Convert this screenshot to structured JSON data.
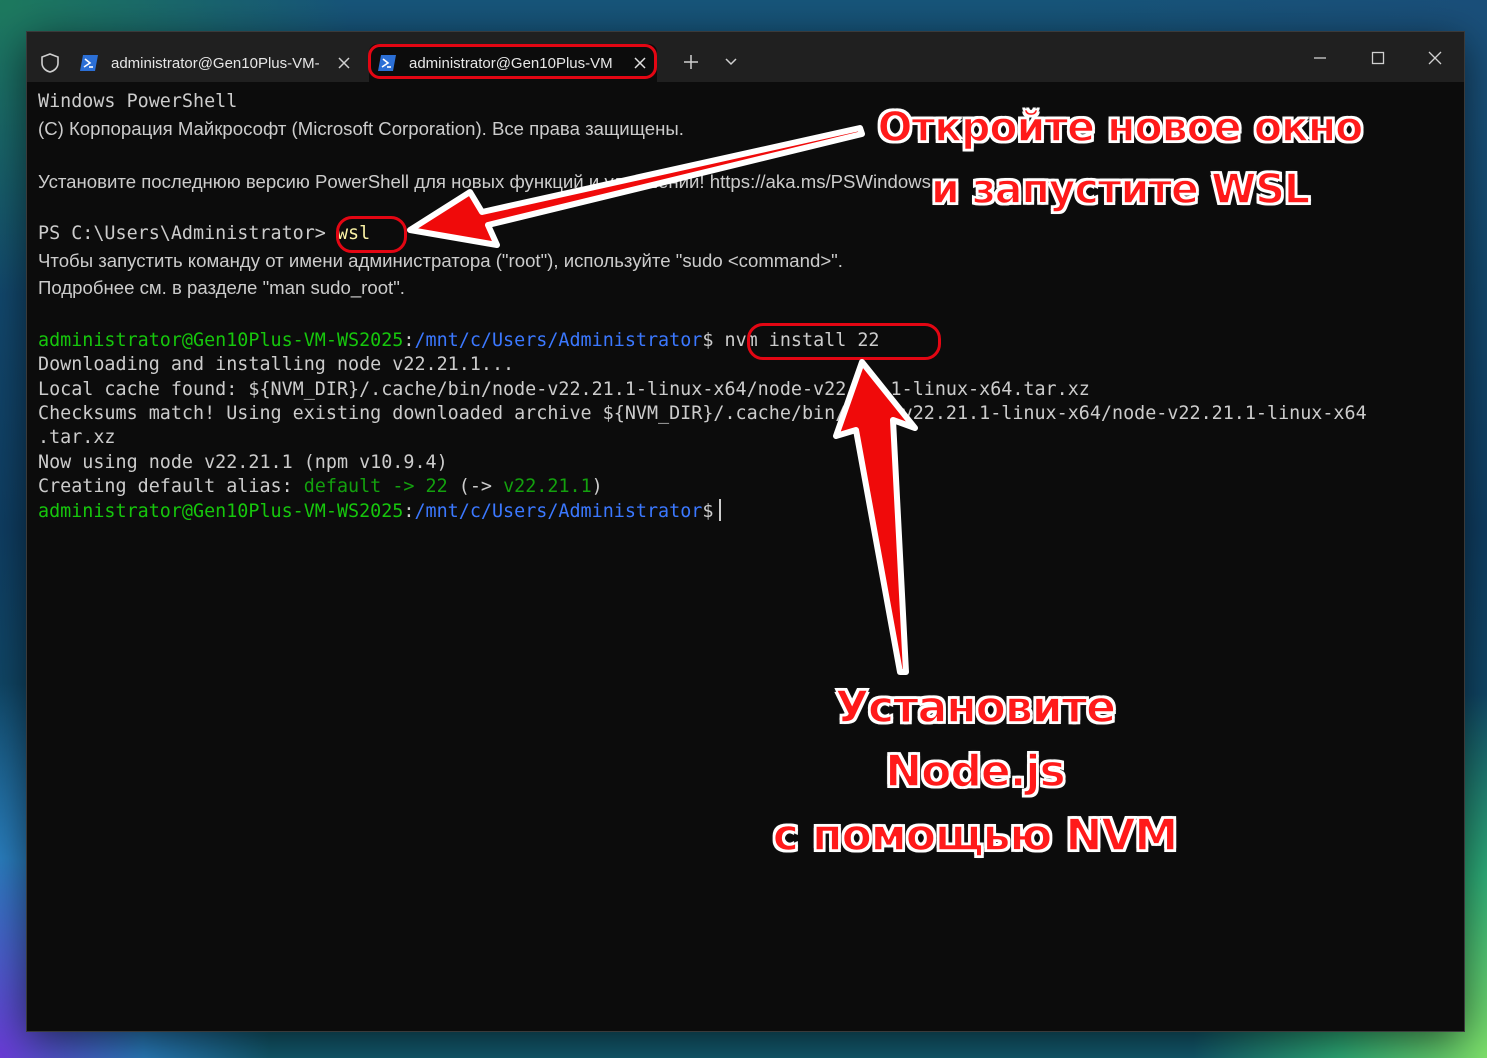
{
  "tabs": [
    {
      "label": "administrator@Gen10Plus-VM-",
      "icon": "powershell-icon",
      "active": false
    },
    {
      "label": "administrator@Gen10Plus-VM",
      "icon": "powershell-icon",
      "active": true
    }
  ],
  "terminal": {
    "header1": "Windows PowerShell",
    "header2": "(C) Корпорация Майкрософт (Microsoft Corporation). Все права защищены.",
    "tip": "Установите последнюю версию PowerShell для новых функций и улучшений! https://aka.ms/PSWindows",
    "ps_prompt": "PS C:\\Users\\Administrator>",
    "ps_cmd": "wsl",
    "sudo1": "Чтобы запустить команду от имени администратора (\"root\"), используйте \"sudo <command>\".",
    "sudo2": "Подробнее см. в разделе \"man sudo_root\".",
    "user_host": "administrator@Gen10Plus-VM-WS2025",
    "colon": ":",
    "path": "/mnt/c/Users/Administrator",
    "dollar": "$",
    "nvm_cmd": "nvm install 22",
    "out1": "Downloading and installing node v22.21.1...",
    "out2": "Local cache found: ${NVM_DIR}/.cache/bin/node-v22.21.1-linux-x64/node-v22.21.1-linux-x64.tar.xz",
    "out3": "Checksums match! Using existing downloaded archive ${NVM_DIR}/.cache/bin/node-v22.21.1-linux-x64/node-v22.21.1-linux-x64",
    "out4": ".tar.xz",
    "out5": "Now using node v22.21.1 (npm v10.9.4)",
    "alias_prefix": "Creating default alias: ",
    "alias_default": "default",
    "alias_arrow": " -> ",
    "alias_num": "22",
    "alias_open": " (-> ",
    "alias_version": "v22.21.1",
    "alias_close": ")"
  },
  "annotations": {
    "top_line1": "Откройте новое окно",
    "top_line2": "и запустите WSL",
    "bottom_line1": "Установите Node.js",
    "bottom_line2": "с помощью NVM",
    "accent_color": "#e30613"
  }
}
